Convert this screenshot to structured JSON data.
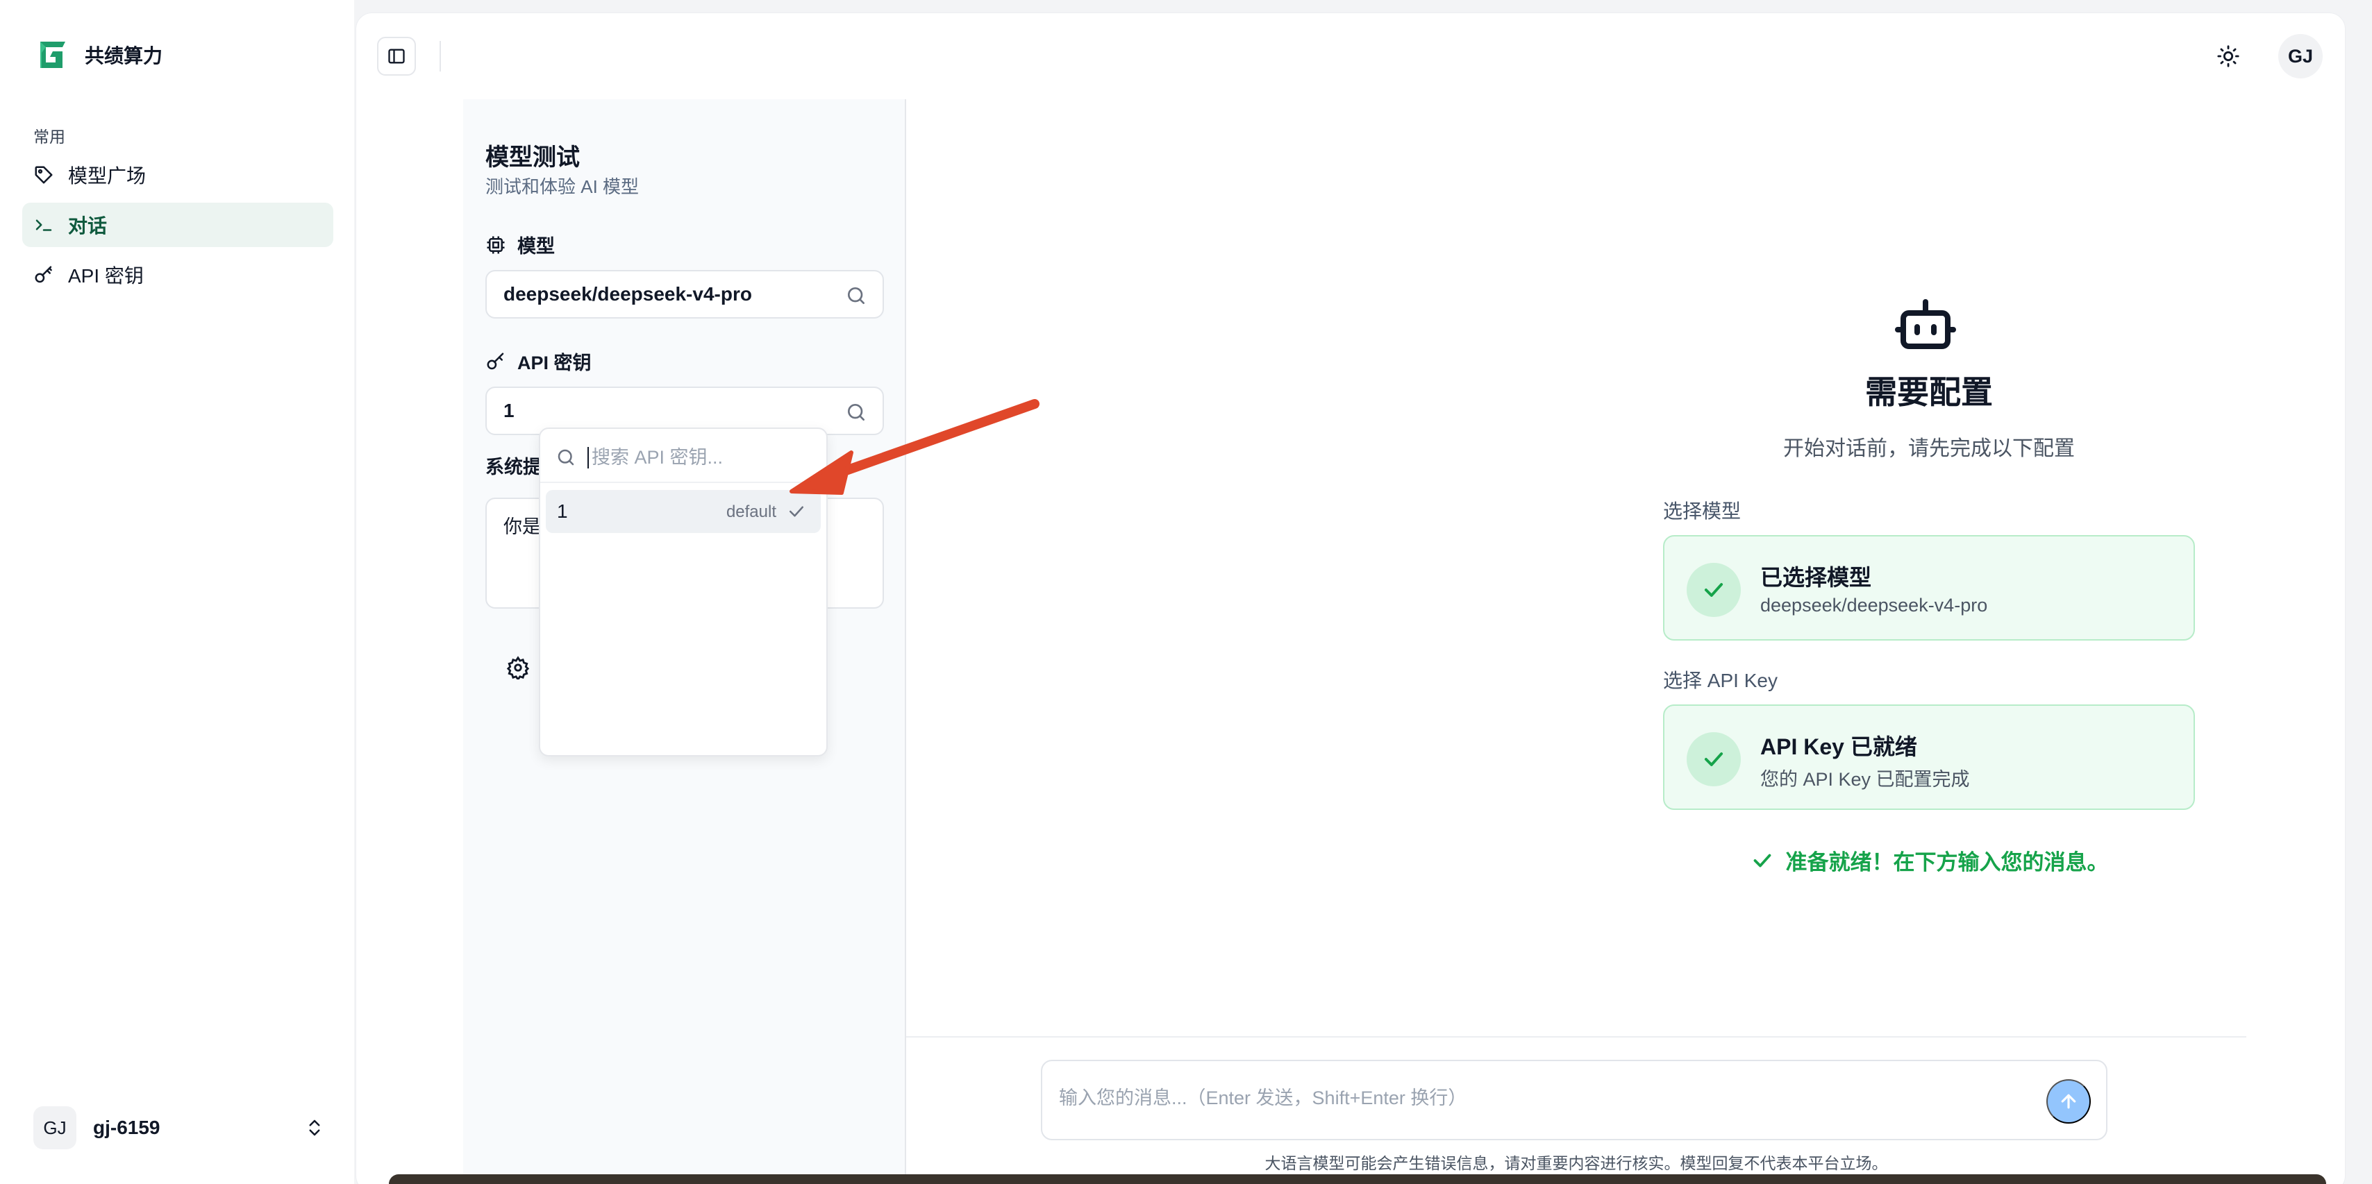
{
  "brand": {
    "name": "共绩算力",
    "accent": "#1f9d6b"
  },
  "sidebar": {
    "section_label": "常用",
    "items": [
      {
        "label": "模型广场",
        "icon": "tag-icon",
        "active": false
      },
      {
        "label": "对话",
        "icon": "terminal-icon",
        "active": true
      },
      {
        "label": "API 密钥",
        "icon": "key-icon",
        "active": false
      }
    ],
    "user": {
      "avatar": "GJ",
      "name": "gj-6159"
    }
  },
  "header": {
    "avatar": "GJ"
  },
  "panel": {
    "title": "模型测试",
    "subtitle": "测试和体验 AI 模型",
    "model_label": "模型",
    "model_value": "deepseek/deepseek-v4-pro",
    "api_label": "API 密钥",
    "api_value": "1",
    "system_label": "系统提",
    "system_text": "你是"
  },
  "dropdown": {
    "search_placeholder": "搜索 API 密钥...",
    "items": [
      {
        "label": "1",
        "tag": "default",
        "selected": true
      }
    ]
  },
  "center": {
    "title": "需要配置",
    "subtitle": "开始对话前，请先完成以下配置",
    "step1_label": "选择模型",
    "card1_title": "已选择模型",
    "card1_sub": "deepseek/deepseek-v4-pro",
    "step2_label": "选择 API Key",
    "card2_title": "API Key 已就绪",
    "card2_sub": "您的 API Key 已配置完成",
    "ready_text": "准备就绪！在下方输入您的消息。"
  },
  "composer": {
    "placeholder": "输入您的消息...（Enter 发送，Shift+Enter 换行）",
    "disclaimer": "大语言模型可能会产生错误信息，请对重要内容进行核实。模型回复不代表本平台立场。"
  }
}
